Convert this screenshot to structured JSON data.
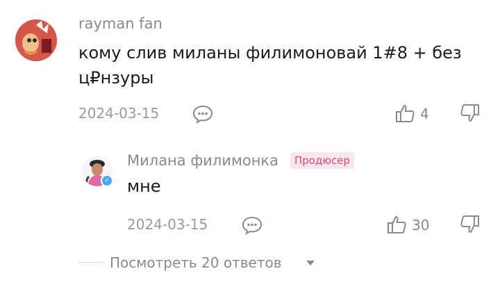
{
  "comment": {
    "username": "rayman fan",
    "text": "кому слив миланы филимоновай 1#8 + без ц₽нзуры",
    "date": "2024-03-15",
    "like_count": "4"
  },
  "reply": {
    "username": "Милана филимонка",
    "badge": "Продюсер",
    "text": "мне",
    "date": "2024-03-15",
    "like_count": "30"
  },
  "view_replies_label": "Посмотреть 20 ответов",
  "icons": {
    "comment": "speech-bubble-icon",
    "like": "thumbs-up-icon",
    "dislike": "thumbs-down-icon",
    "verified": "verified-check-icon",
    "caret": "caret-down-icon"
  },
  "colors": {
    "badge_bg": "#fde6ef",
    "badge_text": "#e0457b",
    "verified": "#4aa8ee"
  }
}
